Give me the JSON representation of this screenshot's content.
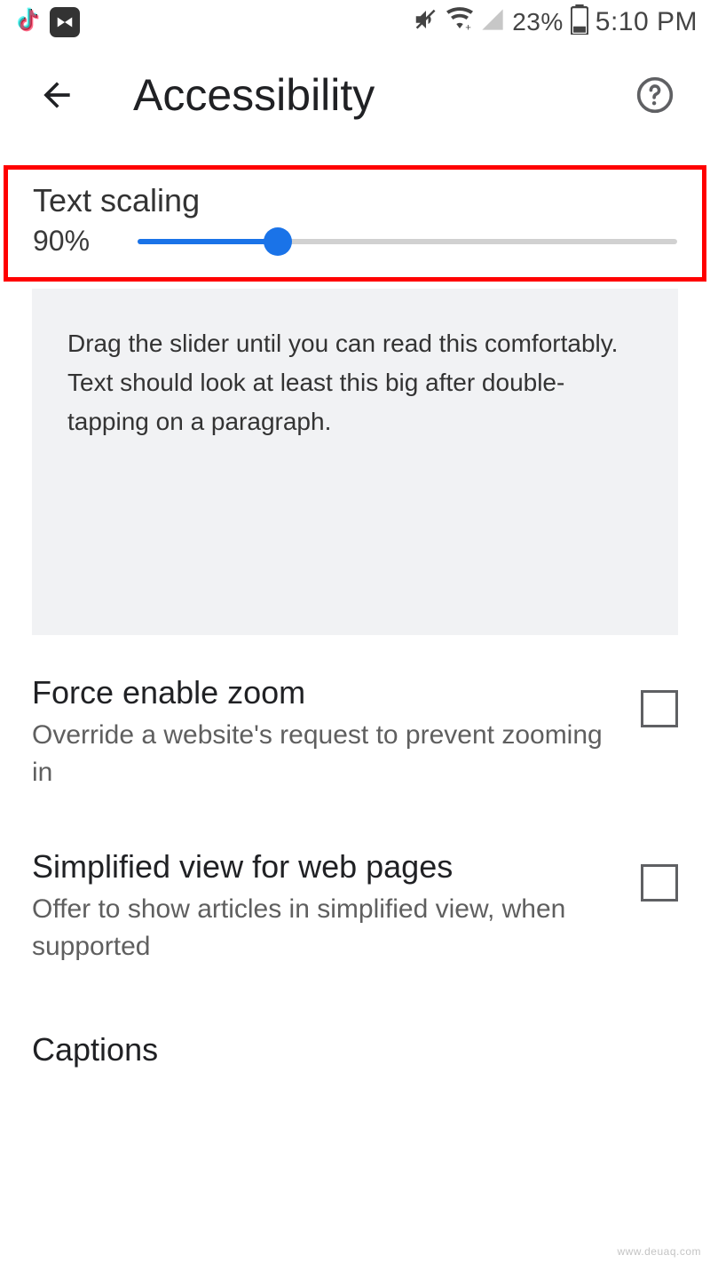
{
  "status": {
    "battery_pct": "23%",
    "time": "5:10 PM"
  },
  "header": {
    "title": "Accessibility"
  },
  "text_scaling": {
    "label": "Text scaling",
    "value_pct": "90%",
    "fill_pct": 26,
    "preview": "Drag the slider until you can read this comfortably. Text should look at least this big after double-tapping on a paragraph."
  },
  "settings": {
    "force_zoom": {
      "title": "Force enable zoom",
      "desc": "Override a website's request to prevent zooming in",
      "checked": false
    },
    "simplified": {
      "title": "Simplified view for web pages",
      "desc": "Offer to show articles in simplified view, when supported",
      "checked": false
    },
    "captions": {
      "title": "Captions"
    }
  },
  "watermark": "www.deuaq.com"
}
